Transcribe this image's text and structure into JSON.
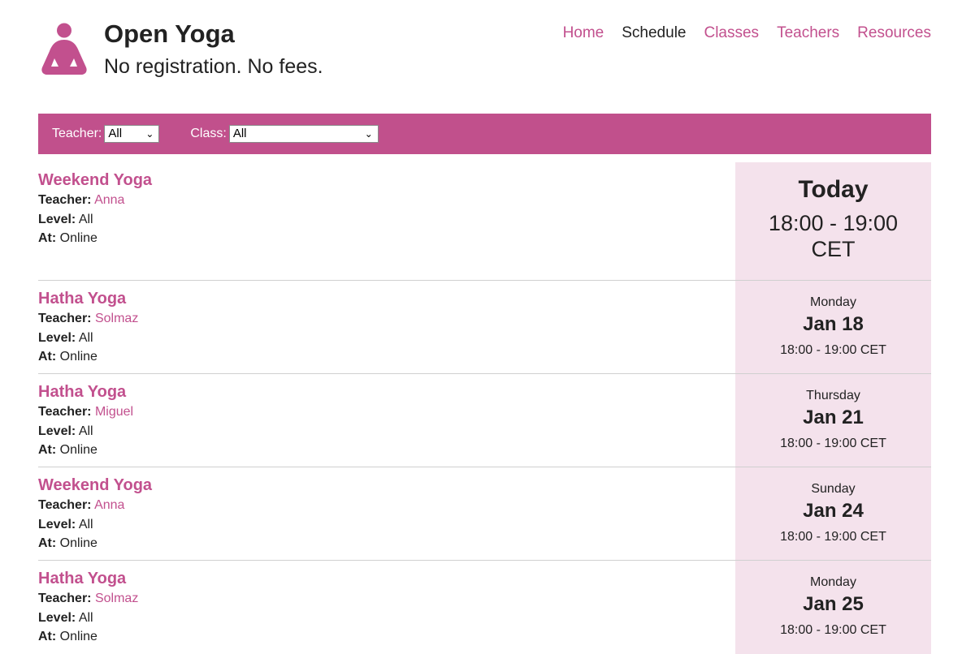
{
  "header": {
    "title": "Open Yoga",
    "tagline": "No registration. No fees.",
    "nav": [
      {
        "label": "Home",
        "current": false
      },
      {
        "label": "Schedule",
        "current": true
      },
      {
        "label": "Classes",
        "current": false
      },
      {
        "label": "Teachers",
        "current": false
      },
      {
        "label": "Resources",
        "current": false
      }
    ]
  },
  "filters": {
    "teacher_label": "Teacher:",
    "teacher_value": "All",
    "class_label": "Class:",
    "class_value": "All"
  },
  "field_labels": {
    "teacher": "Teacher:",
    "level": "Level:",
    "at": "At:"
  },
  "schedule": [
    {
      "name": "Weekend Yoga",
      "teacher": "Anna",
      "level": "All",
      "at": "Online",
      "today_label": "Today",
      "time_line1": "18:00 - 19:00",
      "time_line2": "CET"
    },
    {
      "name": "Hatha Yoga",
      "teacher": "Solmaz",
      "level": "All",
      "at": "Online",
      "weekday": "Monday",
      "date": "Jan 18",
      "time": "18:00 - 19:00 CET"
    },
    {
      "name": "Hatha Yoga",
      "teacher": "Miguel",
      "level": "All",
      "at": "Online",
      "weekday": "Thursday",
      "date": "Jan 21",
      "time": "18:00 - 19:00 CET"
    },
    {
      "name": "Weekend Yoga",
      "teacher": "Anna",
      "level": "All",
      "at": "Online",
      "weekday": "Sunday",
      "date": "Jan 24",
      "time": "18:00 - 19:00 CET"
    },
    {
      "name": "Hatha Yoga",
      "teacher": "Solmaz",
      "level": "All",
      "at": "Online",
      "weekday": "Monday",
      "date": "Jan 25",
      "time": "18:00 - 19:00 CET"
    }
  ],
  "colors": {
    "accent": "#c2508e",
    "filter_bar": "#c1508c",
    "date_panel": "#f4e2ec"
  },
  "icons": {
    "logo": "meditating-person-icon",
    "select_chevron": "chevron-down-icon"
  }
}
